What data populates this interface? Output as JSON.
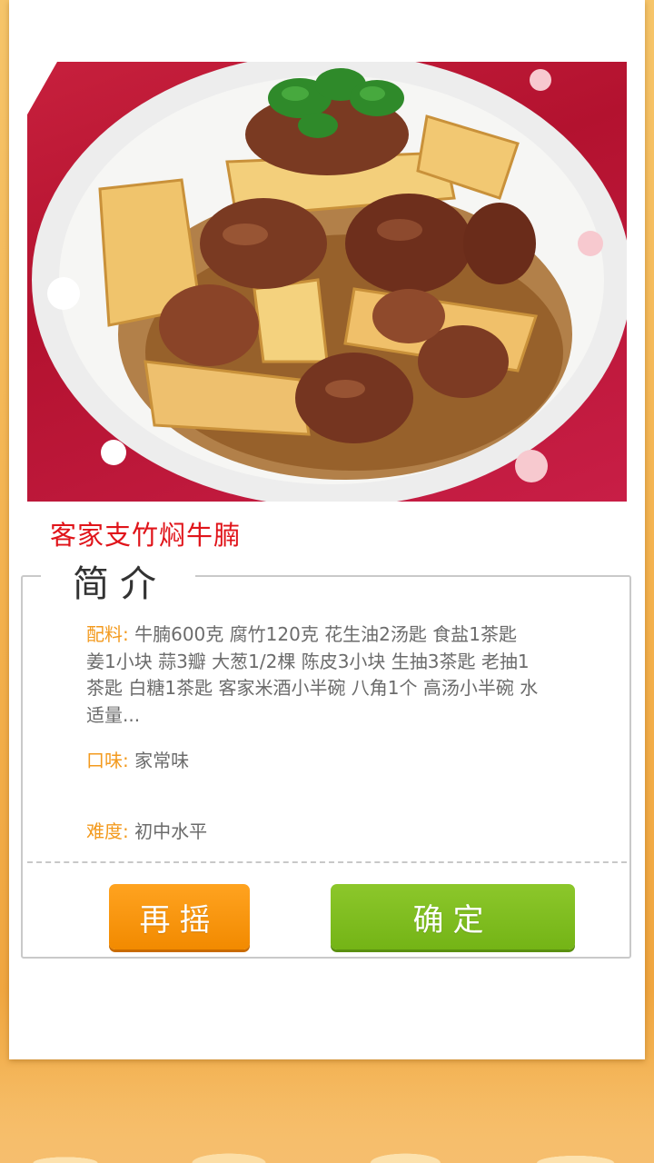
{
  "recipe": {
    "title": "客家支竹焖牛腩",
    "image_name": "beef-brisket-with-tofu-skin-photo"
  },
  "intro": {
    "heading": "简介",
    "ingredients_label": "配料:",
    "ingredients_value": "牛腩600克  腐竹120克  花生油2汤匙  食盐1茶匙  姜1小块  蒜3瓣  大葱1/2棵  陈皮3小块  生抽3茶匙  老抽1茶匙  白糖1茶匙  客家米酒小半碗  八角1个  高汤小半碗  水适量...",
    "taste_label": "口味:",
    "taste_value": "家常味",
    "difficulty_label": "难度:",
    "difficulty_value": "初中水平"
  },
  "actions": {
    "shake_label": "再摇",
    "confirm_label": "确定"
  },
  "colors": {
    "title": "#e0141a",
    "field_key": "#f39a1e",
    "shake_button": "#f7920f",
    "confirm_button": "#80bd20",
    "background": "#f3b04c"
  }
}
